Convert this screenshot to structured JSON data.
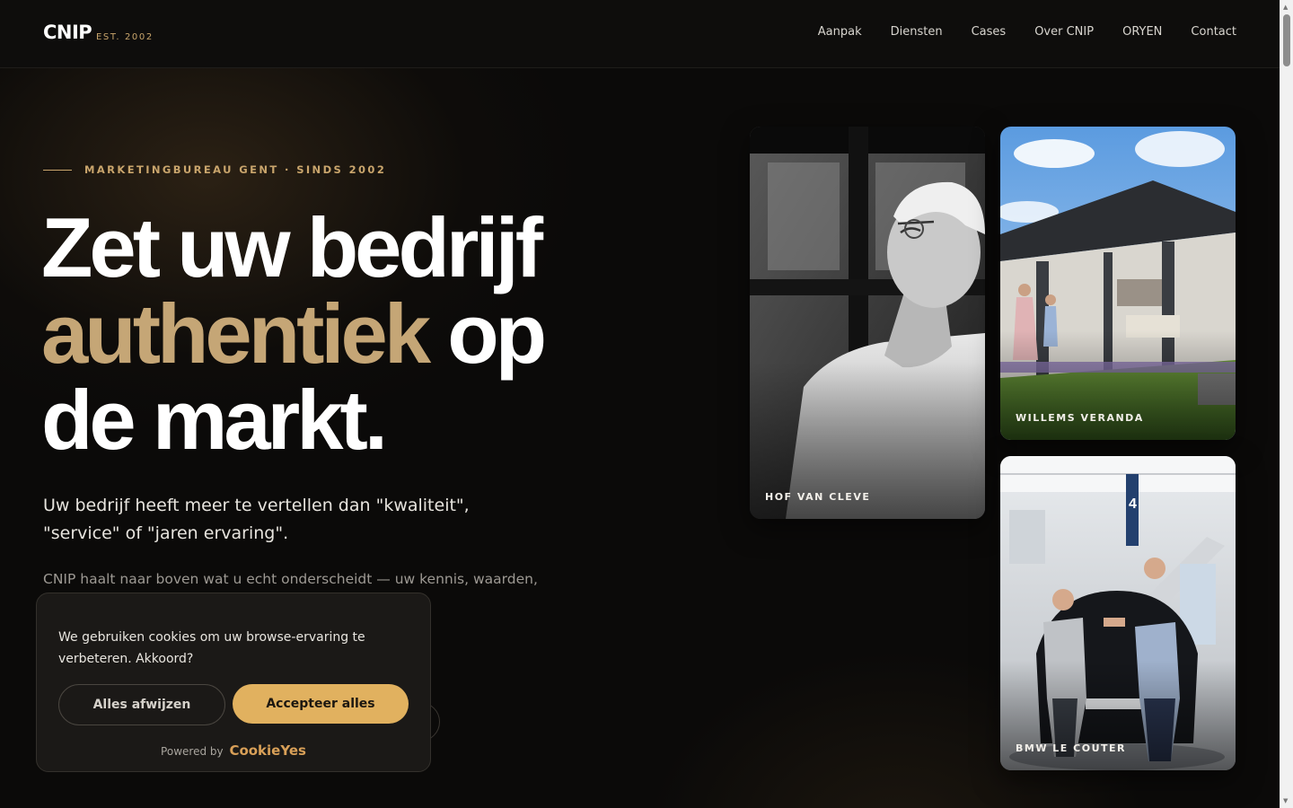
{
  "header": {
    "logo": "CNIP",
    "est": "EST. 2002",
    "nav": [
      "Aanpak",
      "Diensten",
      "Cases",
      "Over CNIP",
      "ORYEN",
      "Contact"
    ]
  },
  "hero": {
    "eyebrow": "MARKETINGBUREAU GENT · SINDS 2002",
    "headline_line1": "Zet uw bedrijf",
    "headline_accent": "authentiek",
    "headline_after_accent": " op",
    "headline_line3": "de markt.",
    "lead": "Uw bedrijf heeft meer te vertellen dan \"kwaliteit\", \"service\" of \"jaren ervaring\".",
    "body": "CNIP haalt naar boven wat u echt onderscheidt — uw kennis, waarden, ebsite, u de juiste"
  },
  "cases": [
    {
      "label": "HOF VAN CLEVE"
    },
    {
      "label": "WILLEMS VERANDA"
    },
    {
      "label": "BMW LE COUTER"
    }
  ],
  "cookie": {
    "text": "We gebruiken cookies om uw browse-ervaring te verbeteren. Akkoord?",
    "reject_label": "Alles afwijzen",
    "accept_label": "Accepteer alles",
    "powered_by": "Powered by",
    "brand": "CookieYes"
  },
  "colors": {
    "accent": "#c5a676",
    "accept_button": "#e1b15f",
    "background": "#0b0a09"
  }
}
